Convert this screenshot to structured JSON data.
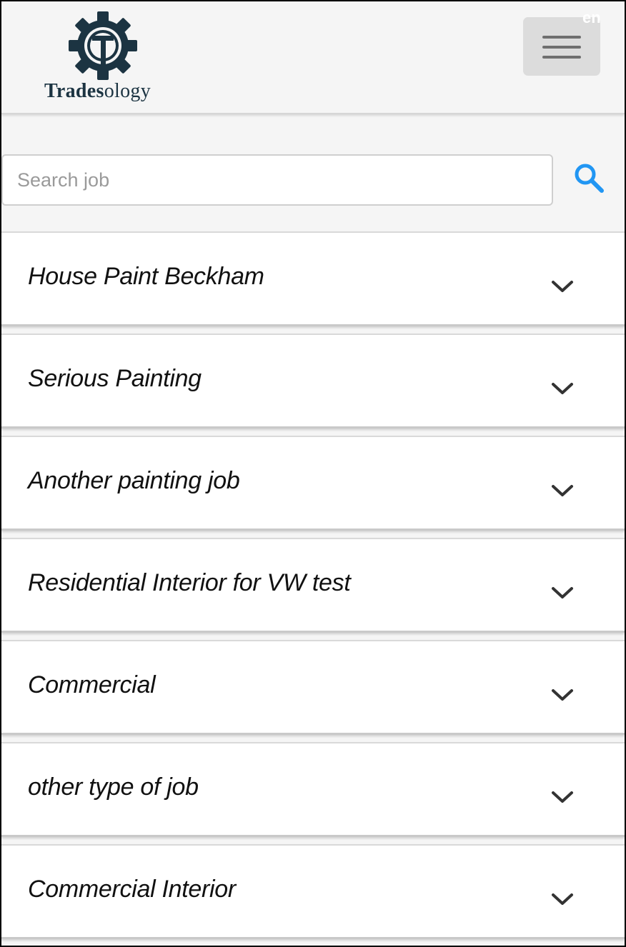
{
  "header": {
    "brand": {
      "bold_part": "Trades",
      "light_part": "ology"
    },
    "language": "en",
    "menu_icon": "hamburger-menu-icon"
  },
  "search": {
    "placeholder": "Search job",
    "value": "",
    "icon": "search-icon",
    "accent_color": "#2196f3"
  },
  "jobs": [
    {
      "title": "House Paint Beckham"
    },
    {
      "title": "Serious Painting"
    },
    {
      "title": "Another painting job"
    },
    {
      "title": "Residential Interior for VW test"
    },
    {
      "title": "Commercial"
    },
    {
      "title": "other type of job"
    },
    {
      "title": "Commercial Interior"
    }
  ],
  "colors": {
    "brand_navy": "#1c3442",
    "header_bg": "#f5f5f5",
    "chevron": "#333333"
  }
}
